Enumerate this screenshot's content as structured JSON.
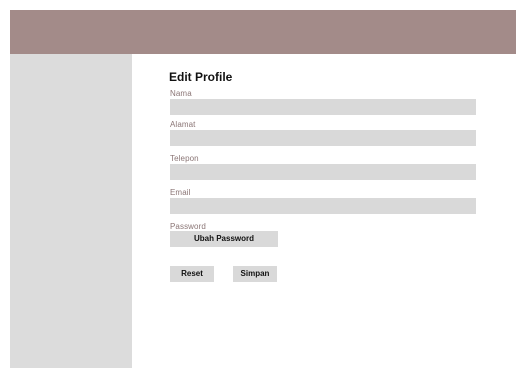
{
  "form": {
    "title": "Edit Profile",
    "fields": [
      {
        "label": "Nama",
        "value": ""
      },
      {
        "label": "Alamat",
        "value": ""
      },
      {
        "label": "Telepon",
        "value": ""
      },
      {
        "label": "Email",
        "value": ""
      }
    ],
    "password": {
      "label": "Password",
      "change_button": "Ubah Password"
    },
    "actions": {
      "reset": "Reset",
      "save": "Simpan"
    }
  },
  "colors": {
    "header": "#a38b89",
    "sidebar": "#dcdcdc",
    "field": "#d9d9d9",
    "label": "#8b7676"
  }
}
